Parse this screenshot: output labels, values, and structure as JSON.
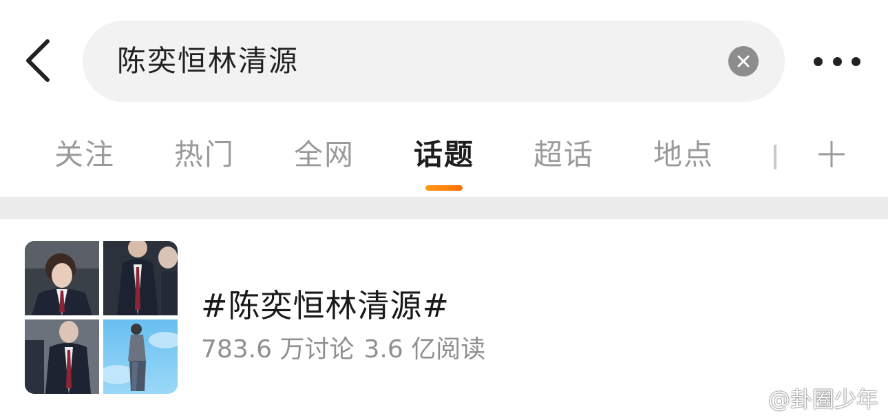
{
  "header": {
    "search_value": "陈奕恒林清源"
  },
  "tabs": [
    {
      "label": "关注",
      "active": false
    },
    {
      "label": "热门",
      "active": false
    },
    {
      "label": "全网",
      "active": false
    },
    {
      "label": "话题",
      "active": true
    },
    {
      "label": "超话",
      "active": false
    },
    {
      "label": "地点",
      "active": false
    }
  ],
  "colors": {
    "tab_indicator": "#ff8a00",
    "search_bg": "#f2f2f2",
    "divider": "#ececec"
  },
  "result": {
    "title": "#陈奕恒林清源#",
    "discussions": "783.6 万讨论",
    "reads": "3.6 亿阅读",
    "thumbnail_icons": [
      "photo",
      "photo",
      "photo",
      "photo"
    ]
  },
  "watermark": {
    "text": "@卦圈少年",
    "icon": "weibo-logo-icon"
  }
}
